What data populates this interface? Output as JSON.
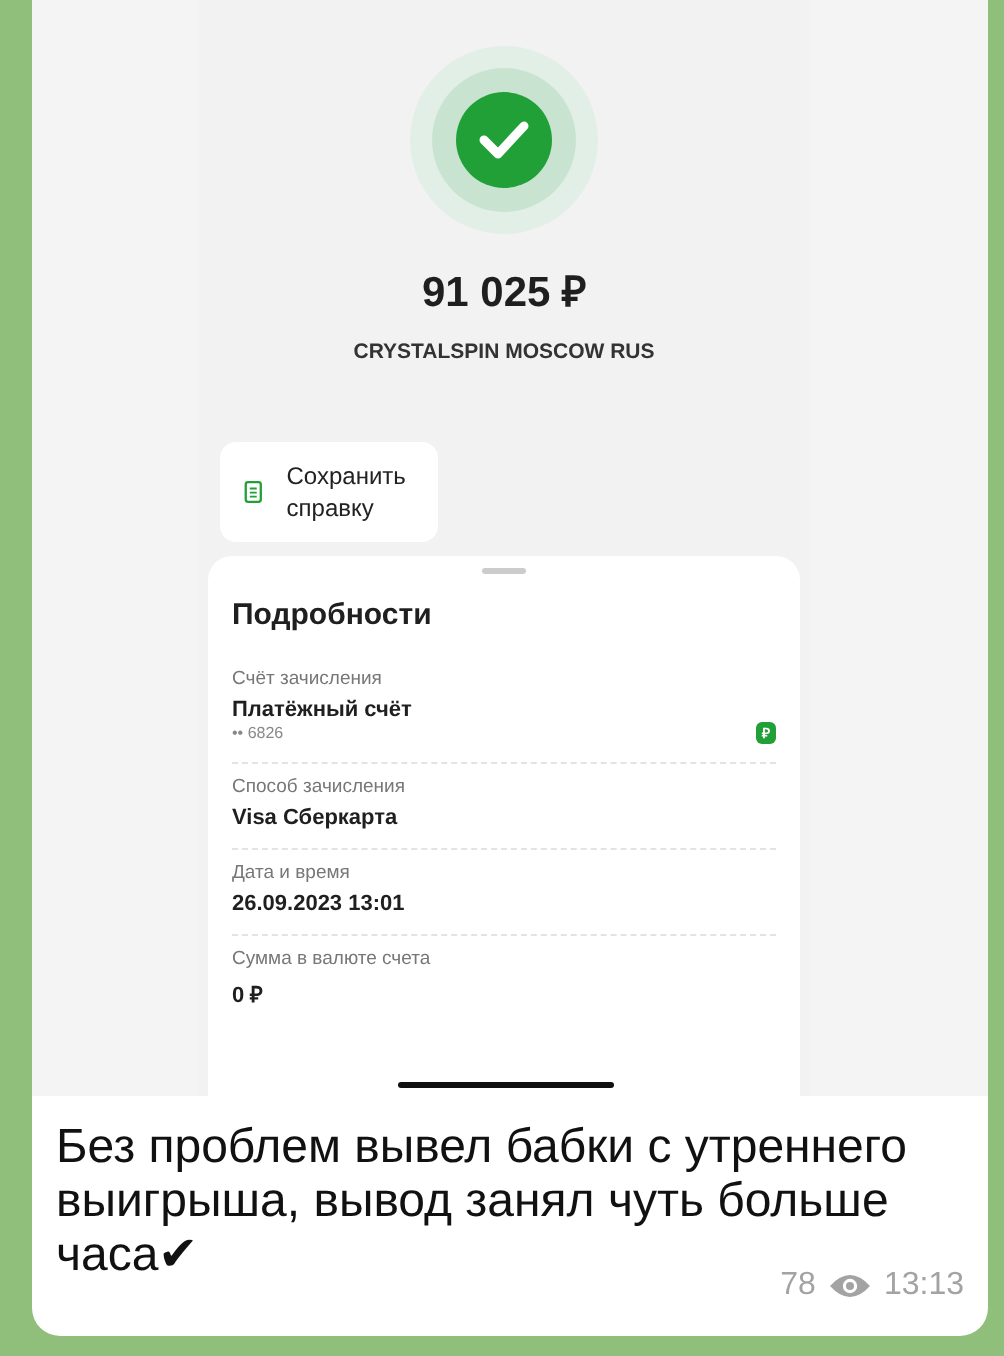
{
  "screenshot": {
    "amount": "91 025 ₽",
    "merchant": "CRYSTALSPIN MOSCOW RUS",
    "save_button": "Сохранить справку",
    "details": {
      "title": "Подробности",
      "fields": [
        {
          "label": "Счёт зачисления",
          "value": "Платёжный счёт",
          "sub": "•• 6826",
          "badge": "₽"
        },
        {
          "label": "Способ зачисления",
          "value": "Visa Сберкарта"
        },
        {
          "label": "Дата и время",
          "value": "26.09.2023 13:01"
        },
        {
          "label": "Сумма в валюте счета",
          "value": "0 ₽"
        }
      ]
    }
  },
  "message": {
    "text": "Без проблем вывел бабки с утреннего выигрыша, вывод занял чуть больше часа✔",
    "views": "78",
    "time": "13:13"
  }
}
